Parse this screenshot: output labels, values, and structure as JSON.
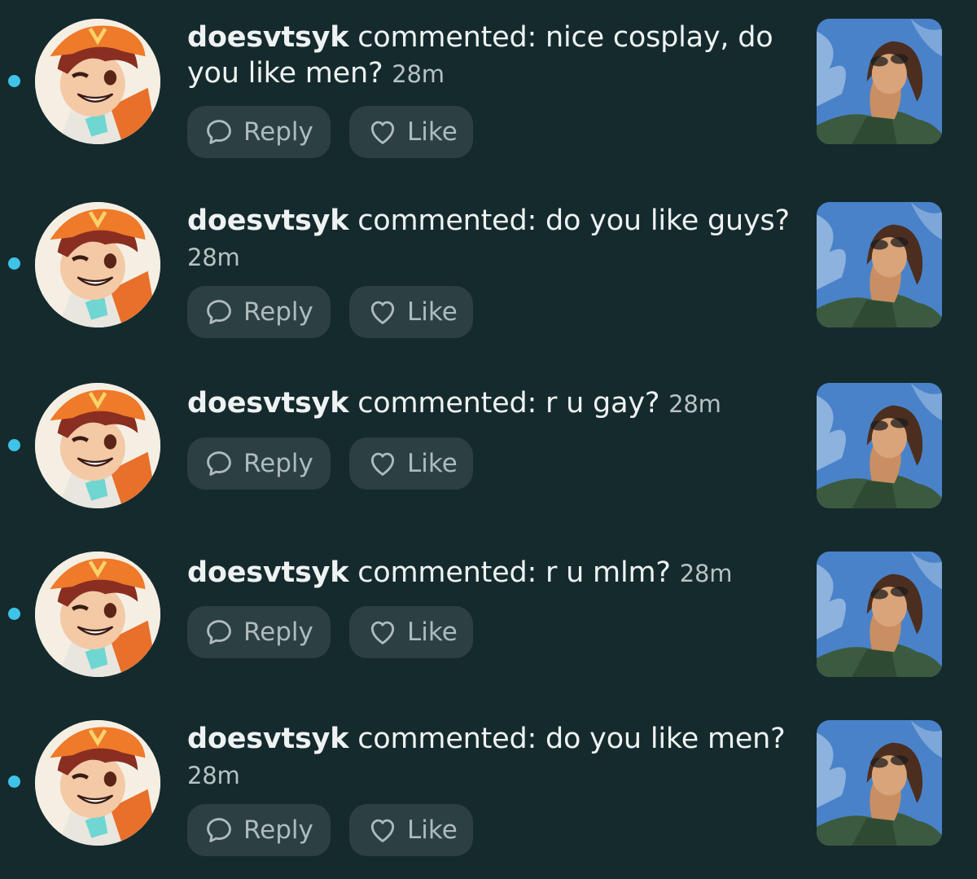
{
  "notifications": [
    {
      "username": "doesvtsyk",
      "action": " commented: ",
      "comment": "nice cosplay, do you like men?",
      "time": "28m",
      "reply_label": "Reply",
      "like_label": "Like"
    },
    {
      "username": "doesvtsyk",
      "action": " commented: ",
      "comment": "do you like guys?",
      "time": "28m",
      "reply_label": "Reply",
      "like_label": "Like"
    },
    {
      "username": "doesvtsyk",
      "action": " commented: ",
      "comment": "r u gay?",
      "time": "28m",
      "reply_label": "Reply",
      "like_label": "Like"
    },
    {
      "username": "doesvtsyk",
      "action": " commented: ",
      "comment": "r u mlm?",
      "time": "28m",
      "reply_label": "Reply",
      "like_label": "Like"
    },
    {
      "username": "doesvtsyk",
      "action": " commented: ",
      "comment": "do you like men?",
      "time": "28m",
      "reply_label": "Reply",
      "like_label": "Like"
    }
  ],
  "icons": {
    "unread": "unread-dot-icon",
    "reply": "speech-bubble-icon",
    "like": "heart-icon"
  },
  "colors": {
    "background": "#152a2d",
    "unread_dot": "#3ec4e8",
    "button": "#2c3f42"
  }
}
